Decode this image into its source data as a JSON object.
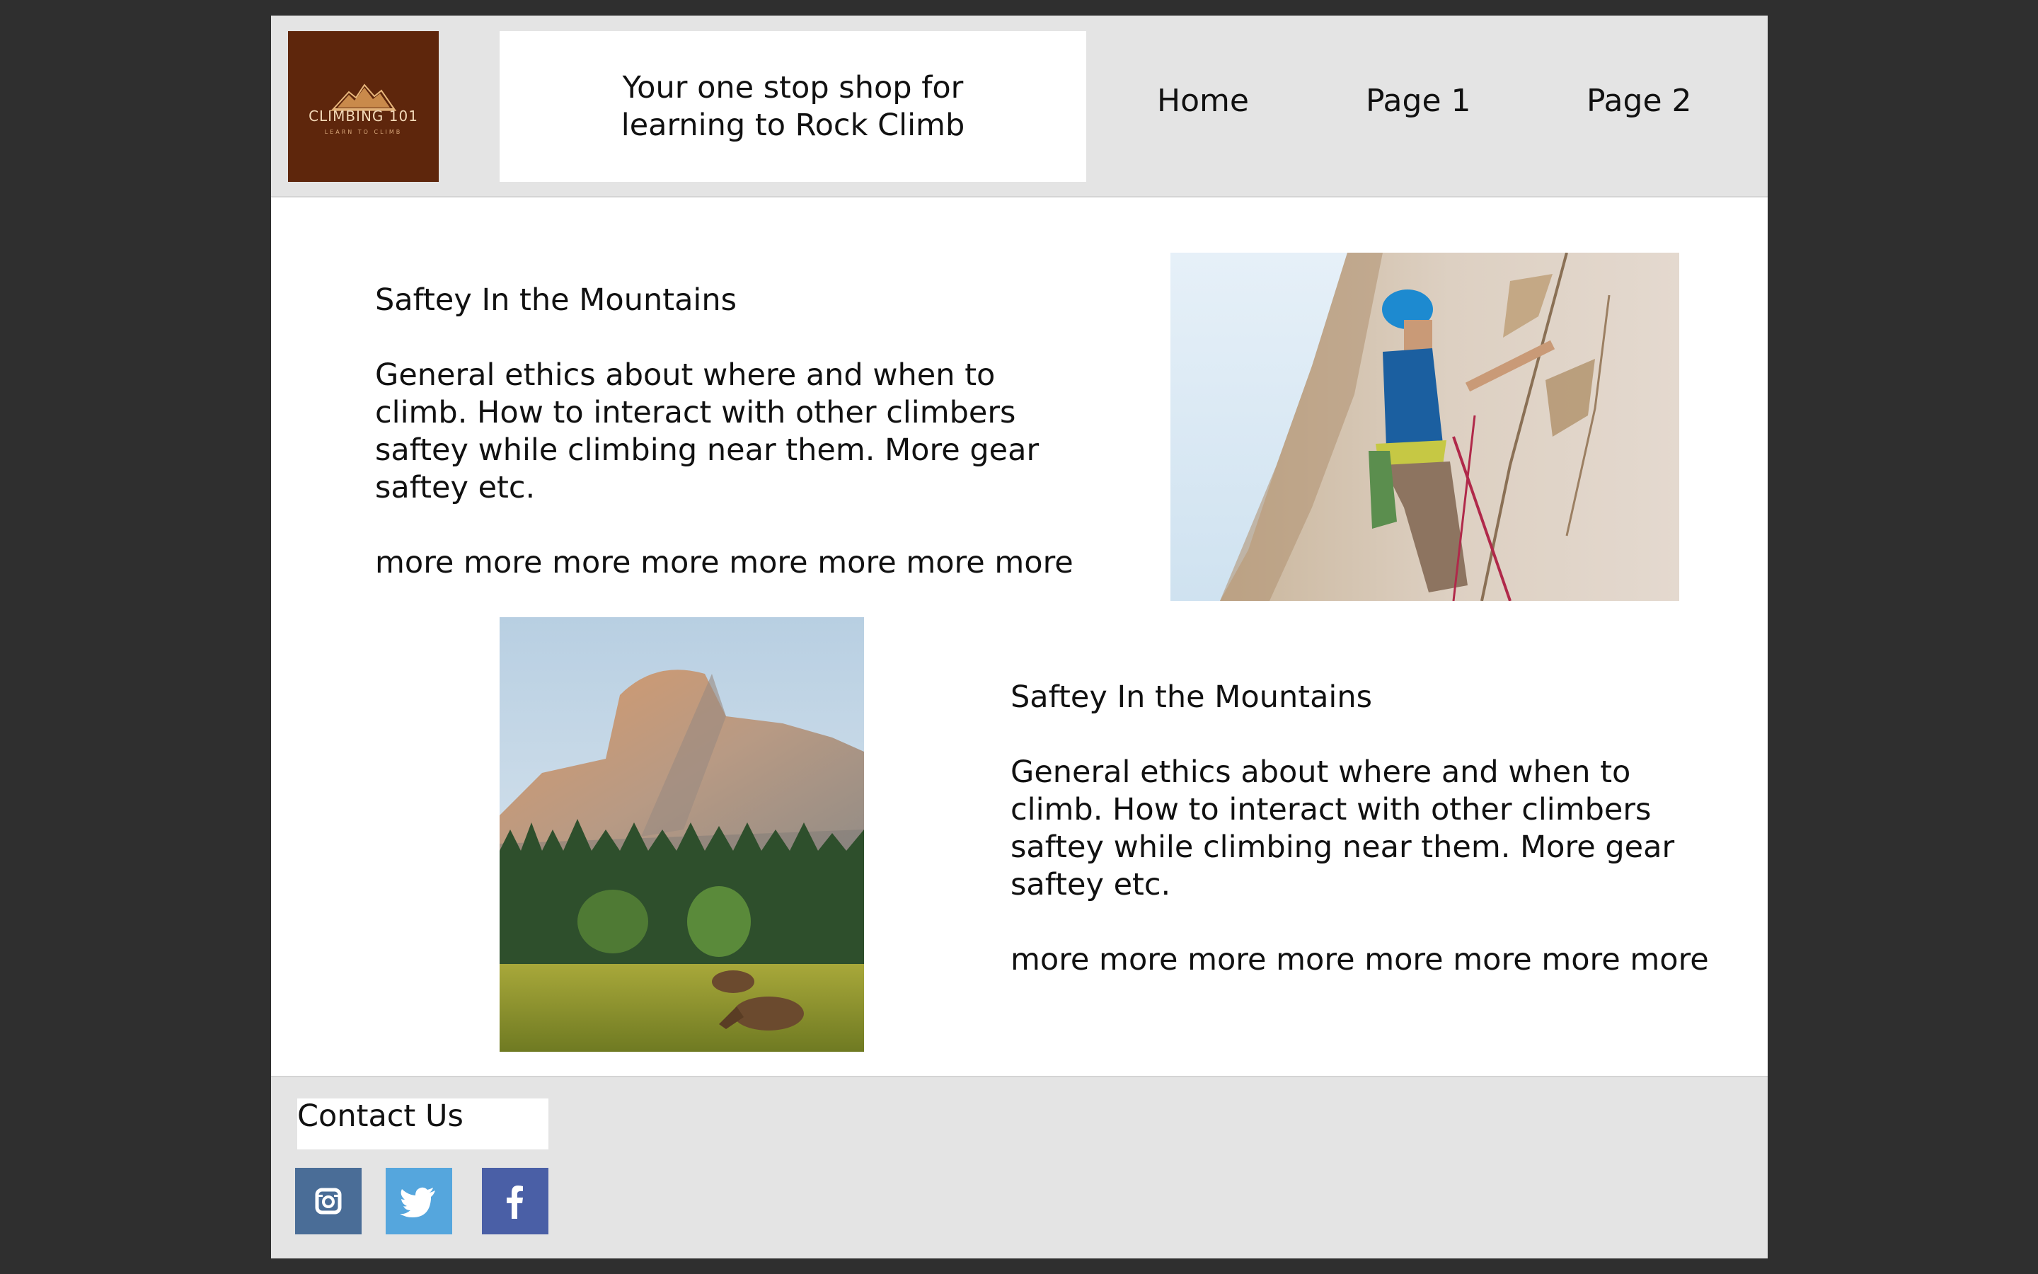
{
  "header": {
    "logo": {
      "title": "CLIMBING 101",
      "subtitle": "LEARN TO CLIMB",
      "icon": "mountain-icon",
      "bg_color": "#5e260c"
    },
    "tagline": "Your one stop shop for learning to Rock Climb",
    "nav": [
      {
        "label": "Home"
      },
      {
        "label": "Page 1"
      },
      {
        "label": "Page 2"
      }
    ]
  },
  "sections": [
    {
      "heading": "Saftey In the Mountains",
      "body": "General ethics about where and when to climb. How to interact with other climbers saftey while climbing near them. More gear saftey etc.",
      "more": "more more more more more more more more",
      "image": "rock-climber-photo"
    },
    {
      "heading": "Saftey In the Mountains",
      "body": "General ethics about where and when to climb. How to interact with other climbers saftey while climbing near them. More gear saftey etc.",
      "more": "more more more more more more more more",
      "image": "half-dome-deer-photo"
    }
  ],
  "footer": {
    "contact_label": "Contact Us",
    "social": [
      {
        "icon": "instagram-icon",
        "color": "#4a6d97"
      },
      {
        "icon": "twitter-icon",
        "color": "#55a6dd"
      },
      {
        "icon": "facebook-icon",
        "color": "#4a5fa6"
      }
    ]
  },
  "colors": {
    "page_bg": "#2f2f2f",
    "header_bg": "#e4e4e4",
    "content_bg": "#ffffff"
  }
}
